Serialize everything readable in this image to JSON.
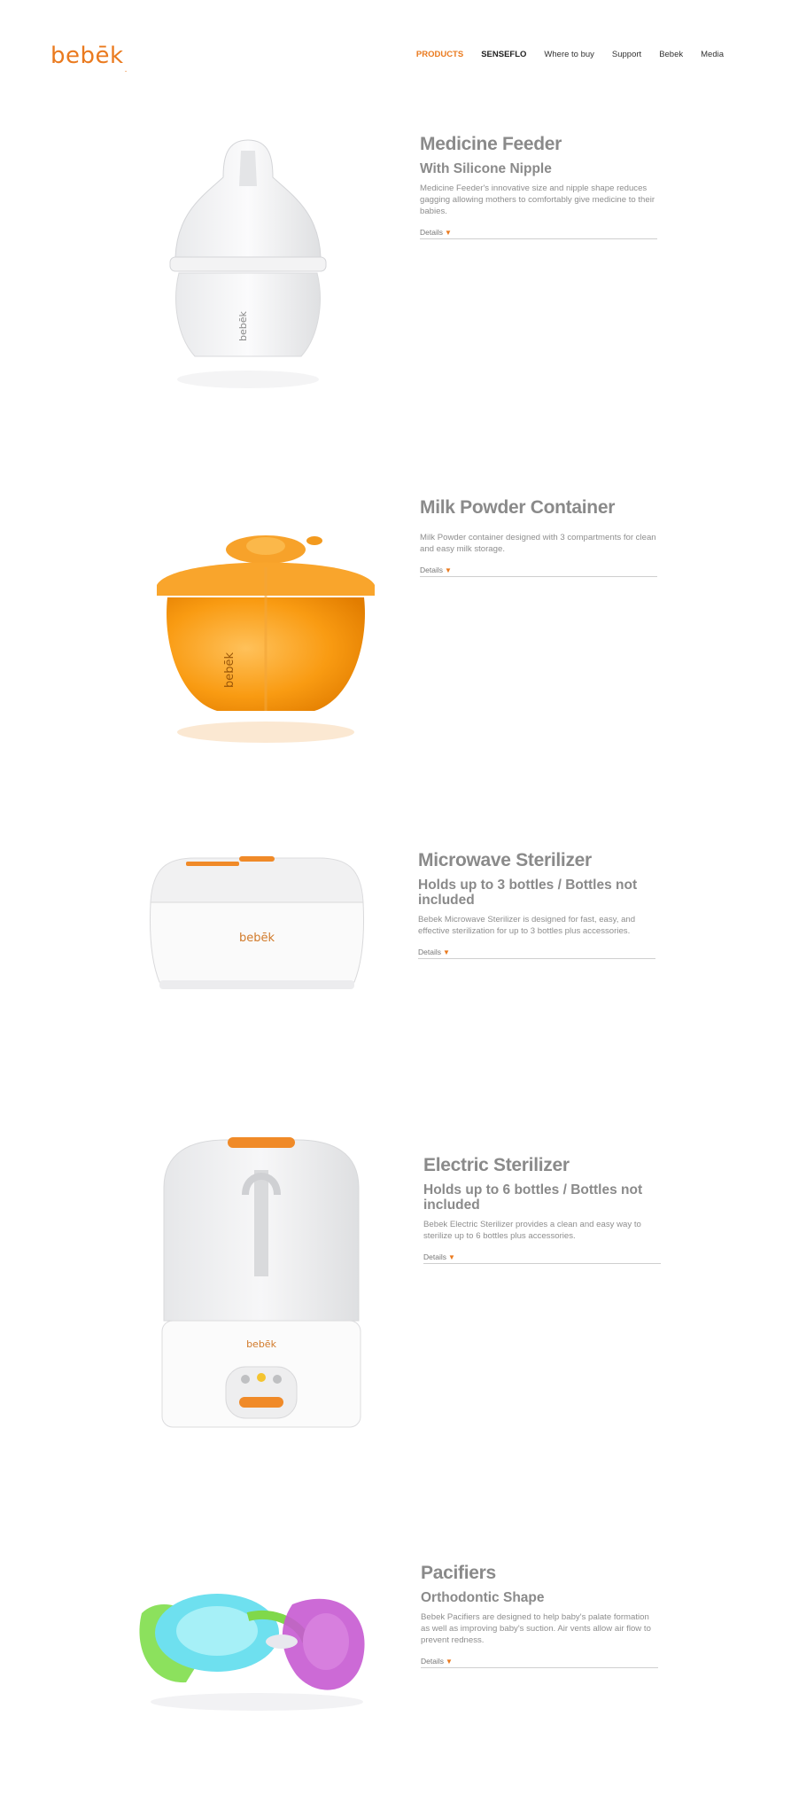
{
  "brand": {
    "logo_text": "bebēk",
    "mark": "."
  },
  "nav": {
    "items": [
      {
        "label": "PRODUCTS",
        "active": true
      },
      {
        "label": "SENSEFLO",
        "active": false
      },
      {
        "label": "Where to buy",
        "active": false
      },
      {
        "label": "Support",
        "active": false
      },
      {
        "label": "Bebek",
        "active": false
      },
      {
        "label": "Media",
        "active": false
      }
    ]
  },
  "products": [
    {
      "title": "Medicine Feeder",
      "subtitle": "With Silicone Nipple",
      "description": "Medicine Feeder's innovative size and nipple shape reduces gagging allowing mothers to comfortably give medicine to their babies.",
      "details_label": "Details"
    },
    {
      "title": "Milk Powder Container",
      "subtitle": "",
      "description": "Milk Powder container designed with 3 compartments for clean and easy milk storage.",
      "details_label": "Details"
    },
    {
      "title": "Microwave Sterilizer",
      "subtitle": "Holds up to 3 bottles / Bottles not included",
      "description": "Bebek Microwave Sterilizer is designed for fast, easy, and effective sterilization for up to 3 bottles plus accessories.",
      "details_label": "Details"
    },
    {
      "title": "Electric Sterilizer",
      "subtitle": "Holds up to 6 bottles / Bottles not included",
      "description": "Bebek Electric Sterilizer provides a clean and easy way to sterilize up to 6 bottles plus accessories.",
      "details_label": "Details"
    },
    {
      "title": "Pacifiers",
      "subtitle": "Orthodontic Shape",
      "description": "Bebek Pacifiers are designed to help baby's palate formation as well as improving baby's suction. Air vents allow air flow to prevent redness.",
      "details_label": "Details"
    }
  ],
  "colors": {
    "accent": "#ea7a1e",
    "heading": "#8a8a8a",
    "text": "#8e8e8e"
  },
  "icons": {
    "details_arrow": "caret-down-icon"
  }
}
